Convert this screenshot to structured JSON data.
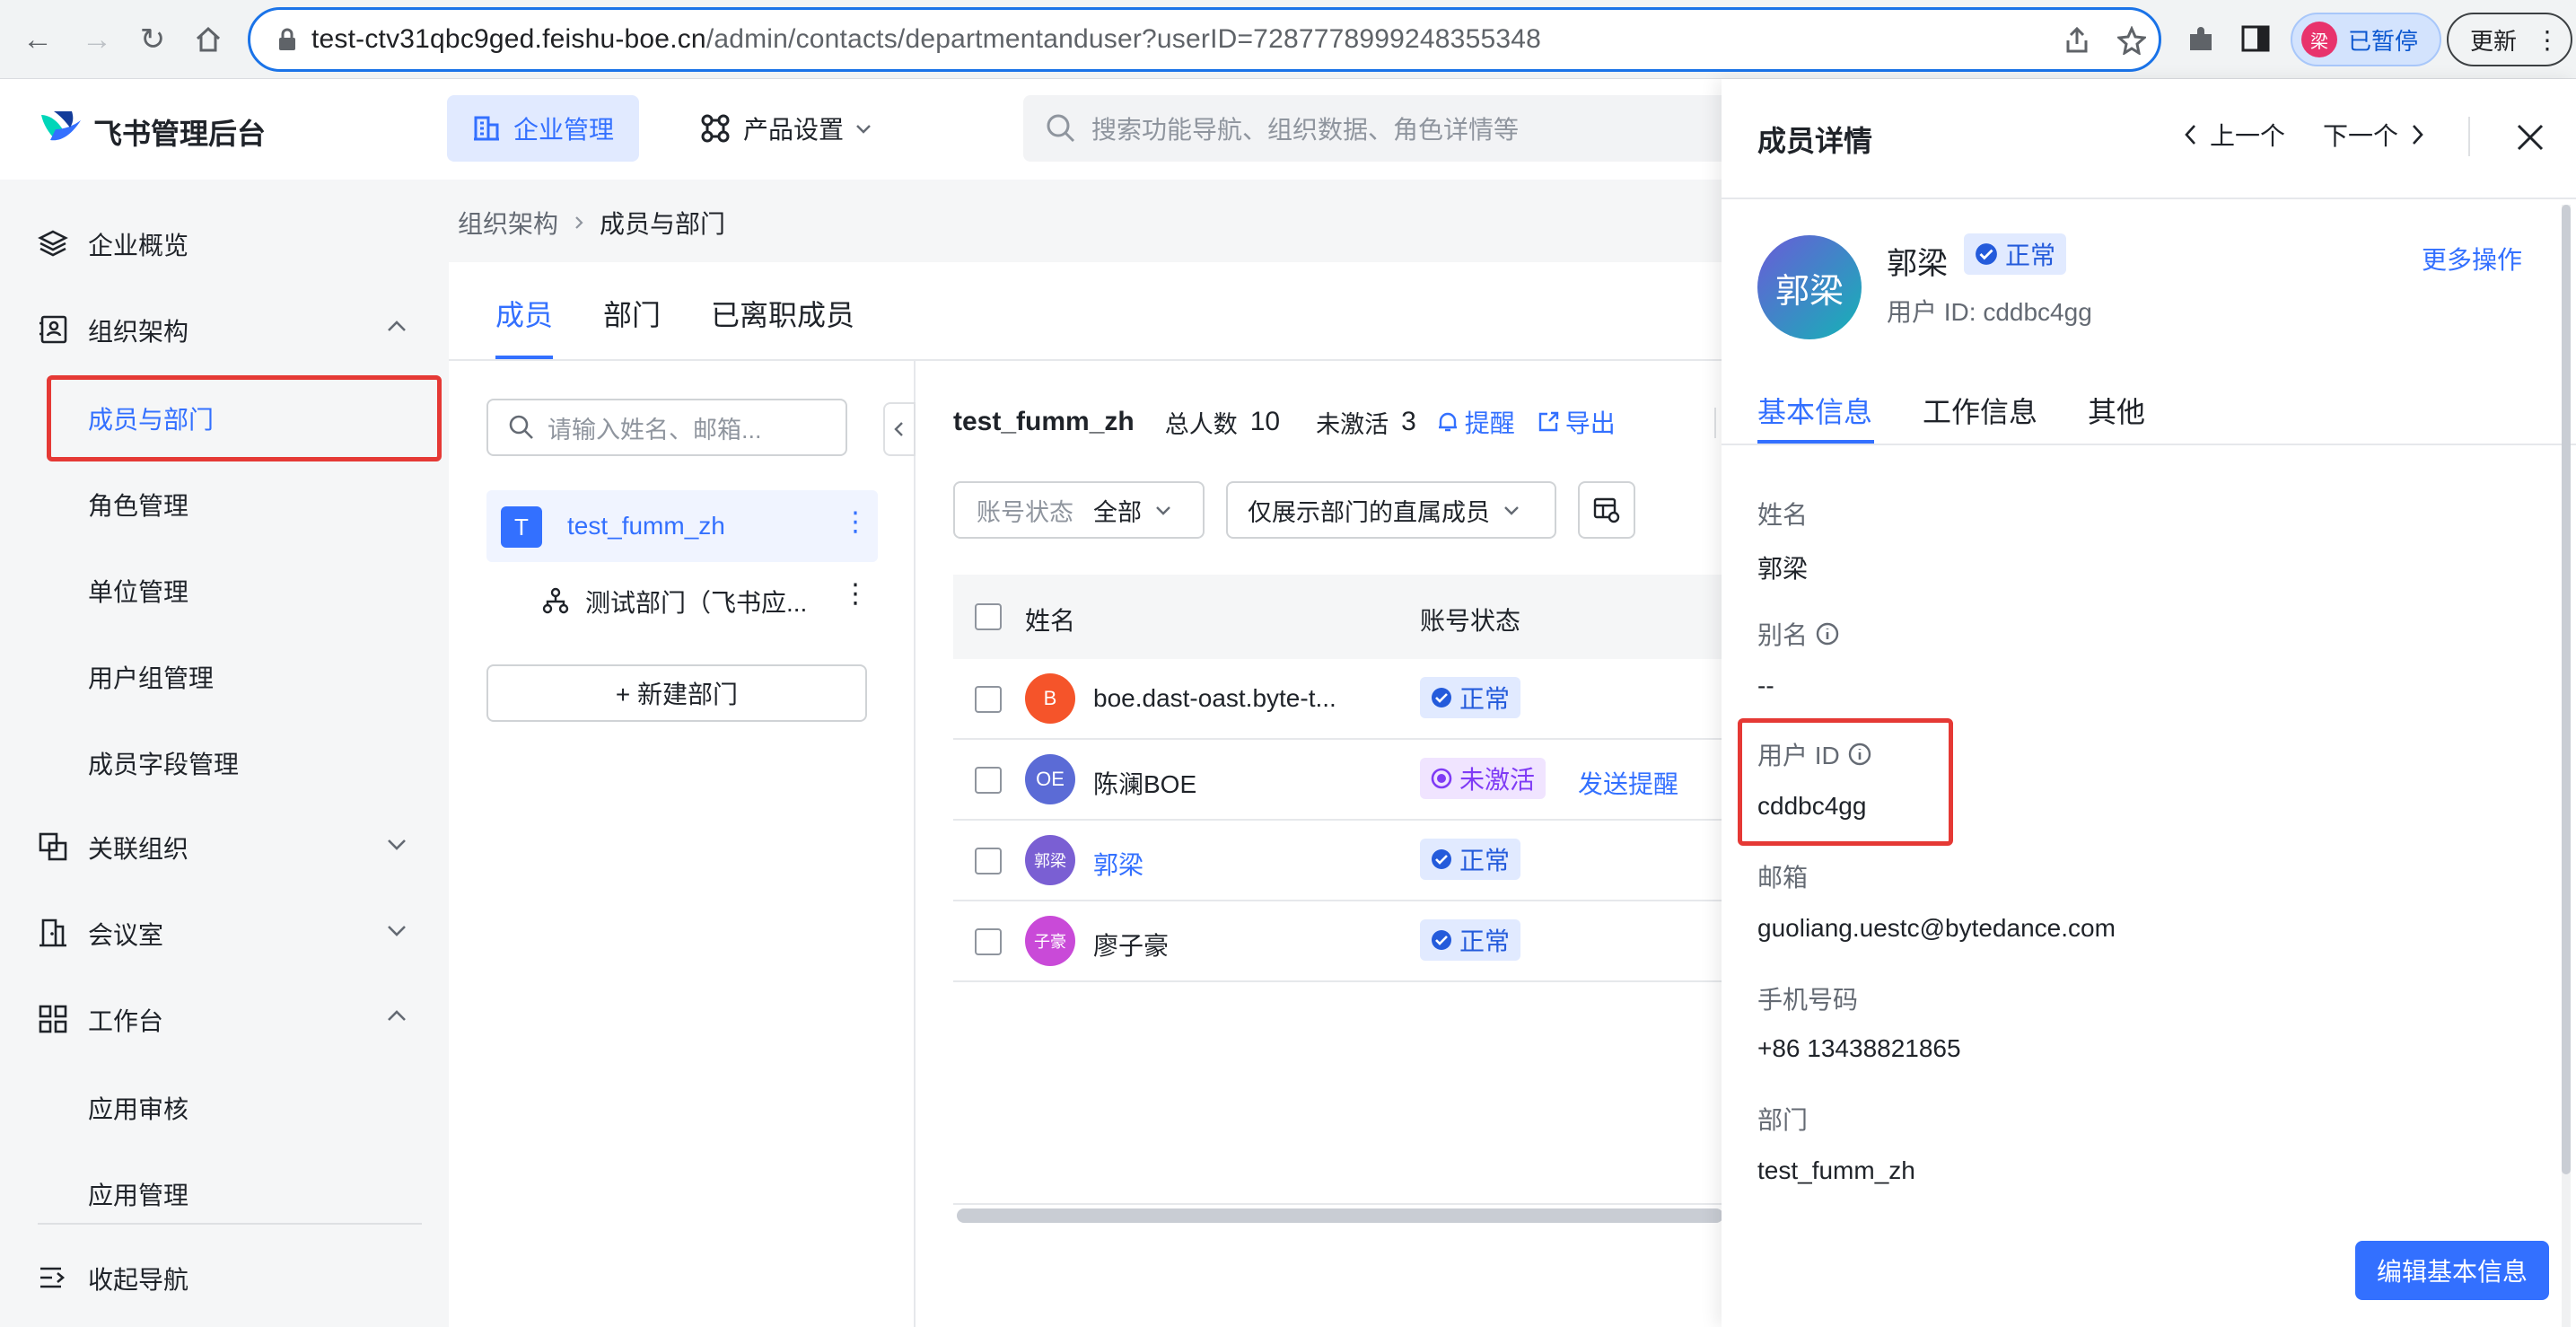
{
  "browser": {
    "url_host": "test-ctv31qbc9ged.feishu-boe.cn",
    "url_path": "/admin/contacts/departmentanduser?userID=7287778999248355348",
    "profile_initial": "梁",
    "profile_status": "已暂停",
    "update_label": "更新"
  },
  "app": {
    "logo_text": "飞书管理后台",
    "nav_enterprise": "企业管理",
    "nav_product": "产品设置",
    "search_placeholder": "搜索功能导航、组织数据、角色详情等"
  },
  "sidebar": {
    "items": [
      {
        "label": "企业概览",
        "icon": "layers-icon"
      },
      {
        "label": "组织架构",
        "icon": "contact-card-icon"
      },
      {
        "label": "成员与部门"
      },
      {
        "label": "角色管理"
      },
      {
        "label": "单位管理"
      },
      {
        "label": "用户组管理"
      },
      {
        "label": "成员字段管理"
      },
      {
        "label": "关联组织",
        "icon": "linked-org-icon"
      },
      {
        "label": "会议室",
        "icon": "meeting-room-icon"
      },
      {
        "label": "工作台",
        "icon": "grid-icon"
      },
      {
        "label": "应用审核"
      },
      {
        "label": "应用管理"
      },
      {
        "label": "收起导航",
        "icon": "collapse-nav-icon"
      }
    ]
  },
  "breadcrumb": {
    "parent": "组织架构",
    "current": "成员与部门"
  },
  "tabs": [
    "成员",
    "部门",
    "已离职成员"
  ],
  "dept_tree": {
    "search_placeholder": "请输入姓名、邮箱...",
    "root_initial": "T",
    "root_name": "test_fumm_zh",
    "child_name": "测试部门（飞书应...",
    "new_dept": "+ 新建部门"
  },
  "member_list": {
    "dept_name": "test_fumm_zh",
    "total_label": "总人数",
    "total_count": "10",
    "inactive_label": "未激活",
    "inactive_count": "3",
    "remind": "提醒",
    "export": "导出",
    "filter_status_label": "账号状态",
    "filter_status_value": "全部",
    "filter_direct": "仅展示部门的直属成员",
    "col_name": "姓名",
    "col_status": "账号状态",
    "rows": [
      {
        "avatar": "B",
        "name": "boe.dast-oast.byte-t...",
        "status": "正常",
        "color": "#f5542a"
      },
      {
        "avatar": "OE",
        "name": "陈澜BOE",
        "status": "未激活",
        "action": "发送提醒",
        "color": "#5b6bd6"
      },
      {
        "avatar": "郭梁",
        "name": "郭梁",
        "status": "正常",
        "color": "#7a5fd3"
      },
      {
        "avatar": "子豪",
        "name": "廖子豪",
        "status": "正常",
        "color": "#c94ad8"
      }
    ]
  },
  "panel": {
    "title": "成员详情",
    "prev": "上一个",
    "next": "下一个",
    "avatar_text": "郭梁",
    "name": "郭梁",
    "status": "正常",
    "user_id_line": "用户 ID: cddbc4gg",
    "more_actions": "更多操作",
    "tabs": [
      "基本信息",
      "工作信息",
      "其他"
    ],
    "fields": [
      {
        "label": "姓名",
        "value": "郭梁"
      },
      {
        "label": "别名",
        "value": "--"
      },
      {
        "label": "用户 ID",
        "value": "cddbc4gg"
      },
      {
        "label": "邮箱",
        "value": "guoliang.uestc@bytedance.com"
      },
      {
        "label": "手机号码",
        "value": "+86 13438821865"
      },
      {
        "label": "部门",
        "value": "test_fumm_zh"
      }
    ],
    "edit_button": "编辑基本信息"
  },
  "colors": {
    "accent": "#3370ff",
    "highlight": "#e53935"
  }
}
